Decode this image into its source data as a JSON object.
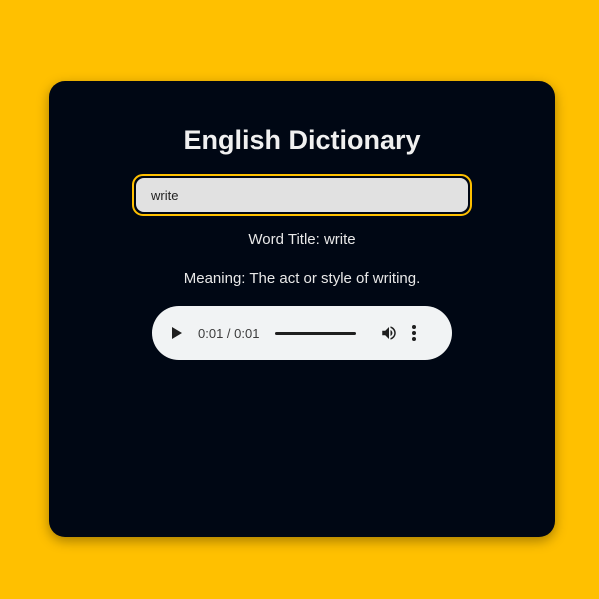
{
  "app": {
    "title": "English Dictionary"
  },
  "search": {
    "value": "write",
    "placeholder": ""
  },
  "result": {
    "word_title": "Word Title: write",
    "meaning": "Meaning: The act or style of writing."
  },
  "audio": {
    "time": "0:01 / 0:01",
    "progress_fraction": 1.0,
    "icons": {
      "play": "play-icon",
      "volume": "volume-icon",
      "menu": "more-vertical-icon"
    }
  },
  "colors": {
    "page_background": "#ffc000",
    "card_background": "#000714",
    "accent_border": "#ffc000",
    "input_background": "#e1e1e1",
    "text": "#e8e8e8"
  }
}
